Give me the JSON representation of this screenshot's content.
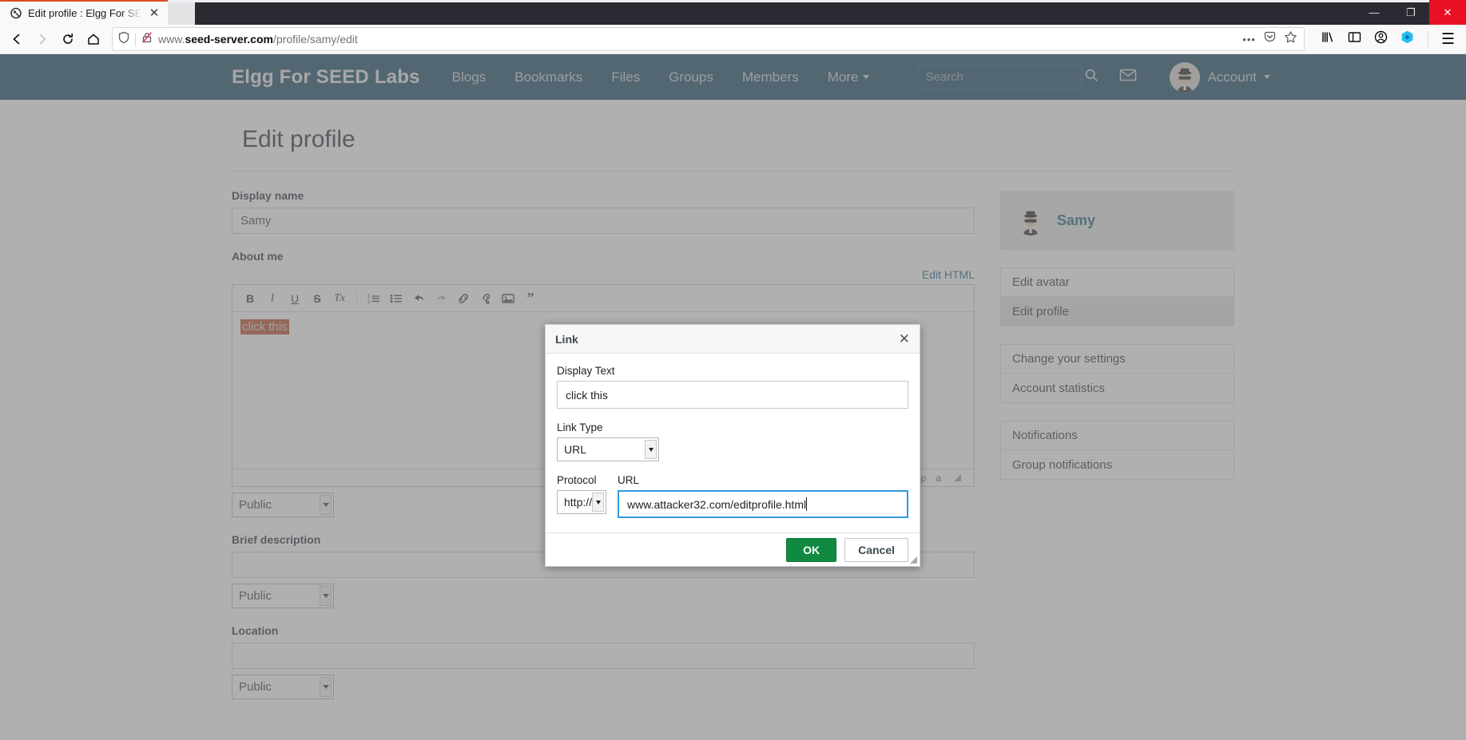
{
  "browser": {
    "tab": {
      "title": "Edit profile : Elgg For SEED Labs",
      "favicon": "elgg-favicon",
      "close": "✕"
    },
    "newtab_label": "+",
    "window_controls": {
      "minimize": "—",
      "maximize": "❐",
      "close": "✕"
    },
    "nav": {
      "back": "←",
      "forward": "→",
      "reload": "⟳",
      "home": "⌂"
    },
    "url": {
      "prefix": "www.",
      "domain": "seed-server.com",
      "path": "/profile/samy/edit",
      "full": "www.seed-server.com/profile/samy/edit"
    },
    "url_icons": {
      "shield": "shield-icon",
      "insecure": "broken-lock-icon",
      "more": "•••",
      "pocket": "pocket-icon",
      "bookmark": "star-icon"
    },
    "toolbar_right": {
      "library": "library-icon",
      "sidebar": "sidebar-icon",
      "account": "account-icon",
      "container": "container-icon",
      "menu": "☰"
    }
  },
  "site": {
    "brand": "Elgg For SEED Labs",
    "nav": [
      {
        "label": "Blogs",
        "caret": false
      },
      {
        "label": "Bookmarks",
        "caret": false
      },
      {
        "label": "Files",
        "caret": false
      },
      {
        "label": "Groups",
        "caret": false
      },
      {
        "label": "Members",
        "caret": false
      },
      {
        "label": "More",
        "caret": true
      }
    ],
    "search": {
      "placeholder": "Search",
      "value": "",
      "icon": "search-icon"
    },
    "mail_icon": "envelope-icon",
    "account": {
      "label": "Account",
      "avatar": "spy-avatar"
    }
  },
  "main": {
    "title": "Edit profile",
    "fields": {
      "display_name": {
        "label": "Display name",
        "value": "Samy"
      },
      "about_me": {
        "label": "About me",
        "edit_html": "Edit HTML",
        "content": "click this",
        "access": "Public"
      },
      "brief_description": {
        "label": "Brief description",
        "value": "",
        "access": "Public"
      },
      "location": {
        "label": "Location",
        "value": "",
        "access": "Public"
      }
    },
    "editor_toolbar": [
      {
        "name": "bold-icon",
        "glyph": "B",
        "dim": false
      },
      {
        "name": "italic-icon",
        "glyph": "I",
        "dim": false
      },
      {
        "name": "underline-icon",
        "glyph": "U",
        "dim": false
      },
      {
        "name": "strikethrough-icon",
        "glyph": "S",
        "dim": false
      },
      {
        "name": "remove-format-icon",
        "glyph": "Tx",
        "dim": false
      },
      {
        "name": "numbered-list-icon",
        "glyph": "list-num",
        "dim": false
      },
      {
        "name": "bullet-list-icon",
        "glyph": "list-bullet",
        "dim": false
      },
      {
        "name": "undo-icon",
        "glyph": "undo",
        "dim": false
      },
      {
        "name": "redo-icon",
        "glyph": "redo",
        "dim": true
      },
      {
        "name": "link-icon",
        "glyph": "link",
        "dim": false
      },
      {
        "name": "unlink-icon",
        "glyph": "unlink",
        "dim": false
      },
      {
        "name": "image-icon",
        "glyph": "image",
        "dim": false
      },
      {
        "name": "blockquote-icon",
        "glyph": "”",
        "dim": false
      }
    ],
    "editor_statusbar": [
      "p",
      "a"
    ]
  },
  "sidebar": {
    "user": {
      "name": "Samy",
      "avatar": "spy-avatar"
    },
    "groups": [
      {
        "items": [
          {
            "label": "Edit avatar",
            "active": false
          },
          {
            "label": "Edit profile",
            "active": true
          }
        ]
      },
      {
        "items": [
          {
            "label": "Change your settings",
            "active": false
          },
          {
            "label": "Account statistics",
            "active": false
          }
        ]
      },
      {
        "items": [
          {
            "label": "Notifications",
            "active": false
          },
          {
            "label": "Group notifications",
            "active": false
          }
        ]
      }
    ]
  },
  "modal": {
    "title": "Link",
    "close": "✕",
    "display_text": {
      "label": "Display Text",
      "value": "click this"
    },
    "link_type": {
      "label": "Link Type",
      "value": "URL"
    },
    "protocol": {
      "label": "Protocol",
      "value": "http://"
    },
    "url": {
      "label": "URL",
      "value": "www.attacker32.com/editprofile.html"
    },
    "buttons": {
      "ok": "OK",
      "cancel": "Cancel"
    }
  },
  "colors": {
    "header_bg": "#0b415c",
    "accent_link": "#0b5c7e",
    "ok_button": "#118a41",
    "selection_bg": "#b7431e",
    "focus_border": "#2f9ae0",
    "tab_accent": "#d94e1f"
  }
}
